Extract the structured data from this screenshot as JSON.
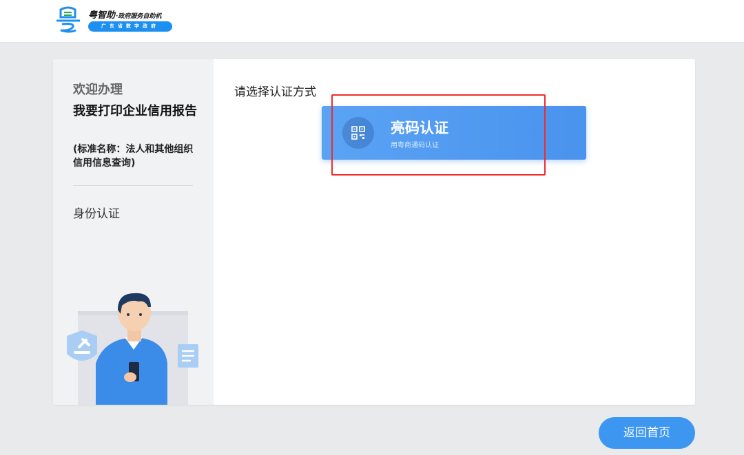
{
  "header": {
    "brand_name": "粤智助",
    "brand_sub": "·政府服务自助机",
    "brand_tagline": "广东省数字政府",
    "logo_icon": "yue-logo-icon"
  },
  "sidebar": {
    "welcome": "欢迎办理",
    "service_title": "我要打印企业信用报告",
    "service_standard_name": "(标准名称：法人和其他组织信用信息查询)",
    "current_step": "身份认证",
    "illustration": "person-with-phone-illustration"
  },
  "main": {
    "prompt": "请选择认证方式",
    "auth_options": [
      {
        "title": "亮码认证",
        "subtitle": "用粤商通码认证",
        "icon": "qr-code-icon"
      }
    ]
  },
  "footer": {
    "home_button": "返回首页"
  },
  "colors": {
    "accent": "#4a93ee",
    "button": "#3d97f1",
    "highlight": "#ef2b2b",
    "brand_blue": "#1d8ff0"
  }
}
